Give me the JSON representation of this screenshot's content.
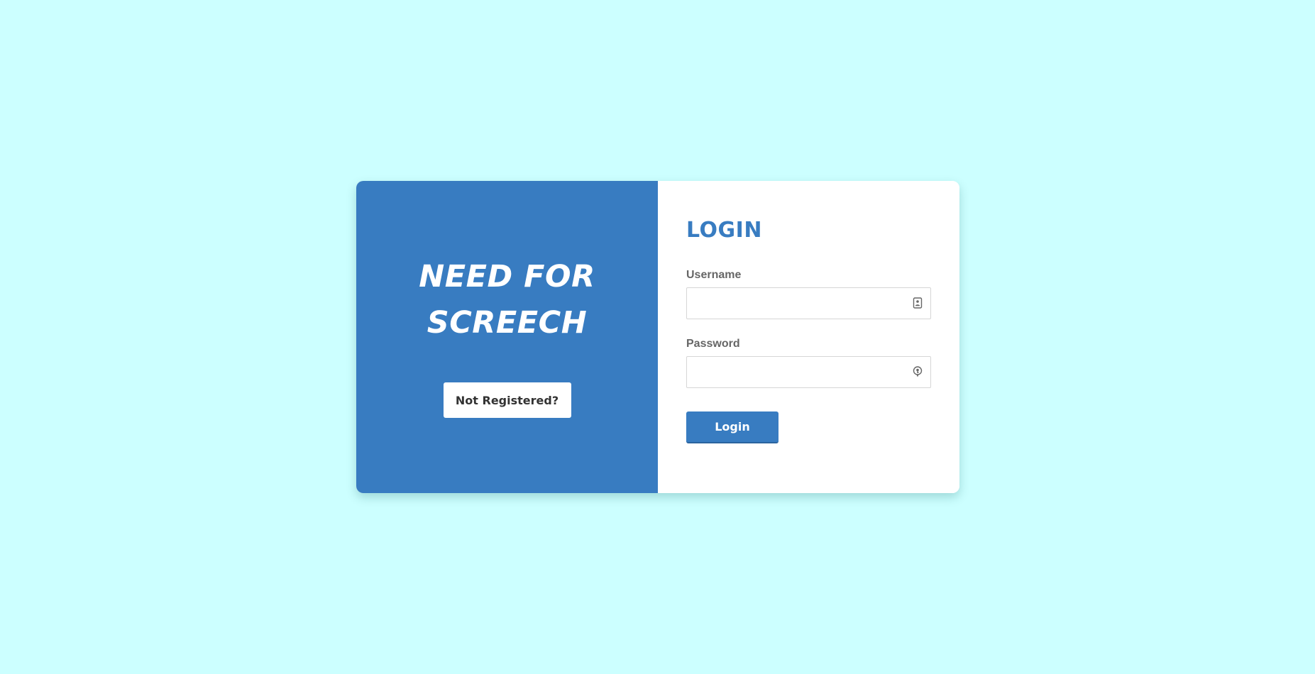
{
  "brand": {
    "title": "NEED FOR SCREECH",
    "register_label": "Not Registered?"
  },
  "login_form": {
    "heading": "LOGIN",
    "username_label": "Username",
    "username_value": "",
    "username_icon": "id-card-icon",
    "password_label": "Password",
    "password_value": "",
    "password_icon": "key-icon",
    "submit_label": "Login"
  },
  "colors": {
    "background": "#ccffff",
    "accent": "#387cc1",
    "panel": "#ffffff",
    "label_text": "#666666"
  }
}
